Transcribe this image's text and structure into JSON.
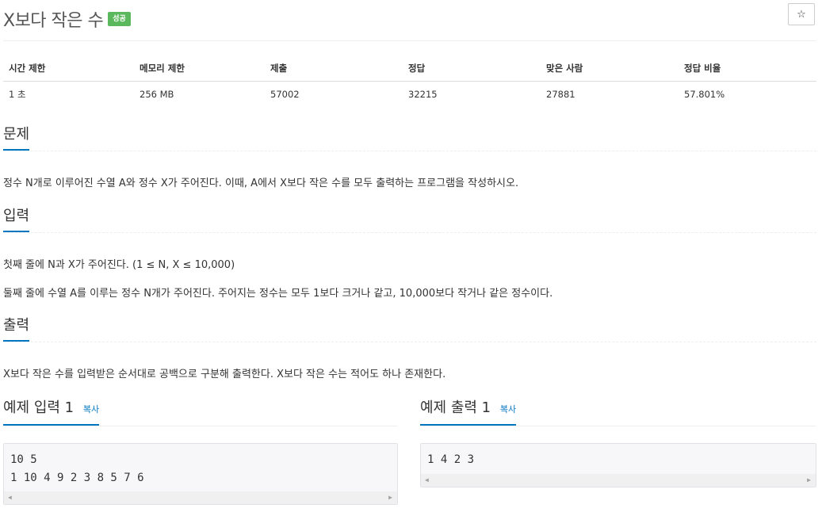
{
  "problem": {
    "title": "X보다 작은 수",
    "badge": "성공",
    "star": "☆"
  },
  "info_table": {
    "headers": [
      "시간 제한",
      "메모리 제한",
      "제출",
      "정답",
      "맞은 사람",
      "정답 비율"
    ],
    "values": [
      "1 초",
      "256 MB",
      "57002",
      "32215",
      "27881",
      "57.801%"
    ]
  },
  "sections": {
    "problem_heading": "문제",
    "problem_text": "정수 N개로 이루어진 수열 A와 정수 X가 주어진다. 이때, A에서 X보다 작은 수를 모두 출력하는 프로그램을 작성하시오.",
    "input_heading": "입력",
    "input_line1": "첫째 줄에 N과 X가 주어진다. (1 ≤ N, X ≤ 10,000)",
    "input_line2": "둘째 줄에 수열 A를 이루는 정수 N개가 주어진다. 주어지는 정수는 모두 1보다 크거나 같고, 10,000보다 작거나 같은 정수이다.",
    "output_heading": "출력",
    "output_text": "X보다 작은 수를 입력받은 순서대로 공백으로 구분해 출력한다. X보다 작은 수는 적어도 하나 존재한다."
  },
  "examples": {
    "input_heading": "예제 입력 1",
    "output_heading": "예제 출력 1",
    "copy_label": "복사",
    "input_lines": [
      "10 5",
      "1 10 4 9 2 3 8 5 7 6"
    ],
    "output_lines": [
      "1 4 2 3"
    ]
  }
}
